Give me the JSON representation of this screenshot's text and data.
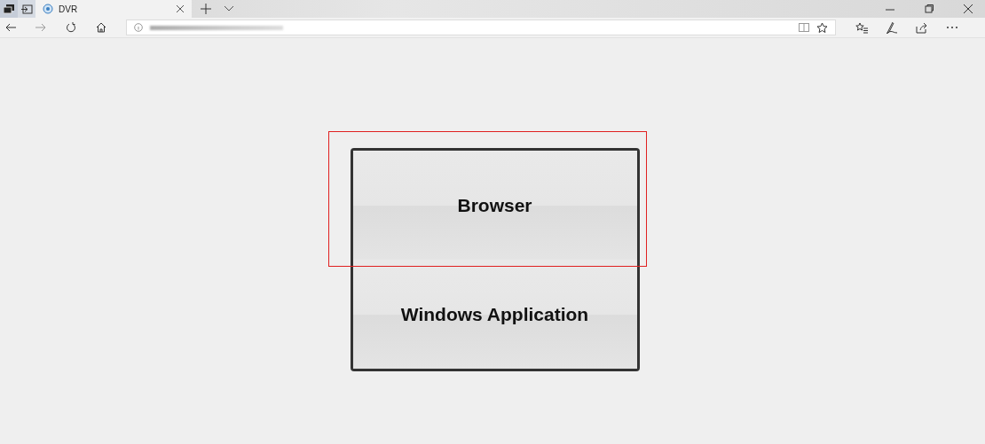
{
  "tabs": [
    {
      "title": "DVR",
      "selected": true
    }
  ],
  "options": [
    {
      "label": "Browser",
      "highlighted": true
    },
    {
      "label": "Windows Application",
      "highlighted": false
    }
  ]
}
